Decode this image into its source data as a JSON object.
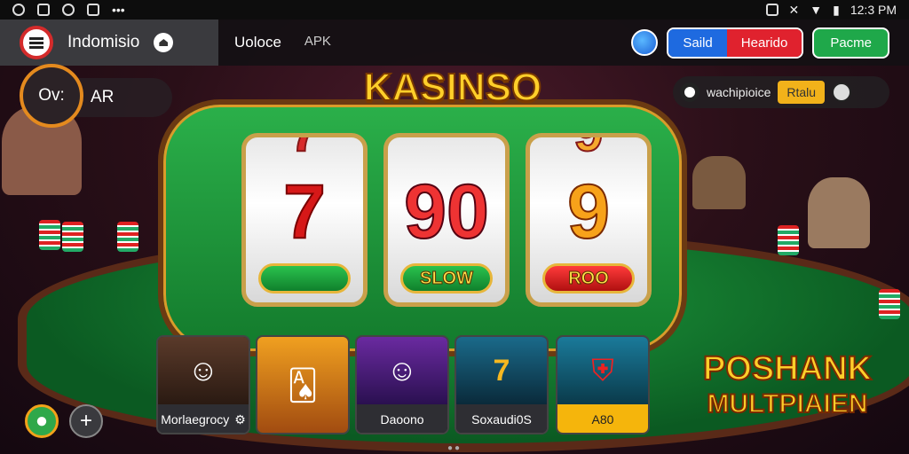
{
  "statusbar": {
    "time": "12:3 PM"
  },
  "appbar": {
    "brand": "Indomisio",
    "nav": [
      "Uoloce",
      "APK"
    ],
    "btn_blue": "Saild",
    "btn_red": "Hearido",
    "btn_green": "Pacme"
  },
  "pill": {
    "circle": "Ov:",
    "label": "AR"
  },
  "chip": {
    "text": "wachipioice",
    "tag": "Rtalu"
  },
  "game": {
    "title": "KASINSO",
    "reels": [
      {
        "symbol": "7",
        "button": ""
      },
      {
        "symbol": "90",
        "button": "SLOW"
      },
      {
        "symbol": "9",
        "button": "ROO"
      }
    ]
  },
  "cards": [
    {
      "caption": "Morlaegrocy",
      "has_icon": true
    },
    {
      "caption": "Daoono"
    },
    {
      "caption": "Soxaudi0S"
    },
    {
      "caption": "A80"
    }
  ],
  "promo": {
    "line1": "POSHANK",
    "line2": "MULTPIAIEN"
  },
  "colors": {
    "accent_green": "#1fa84a",
    "accent_red": "#e0222e",
    "accent_blue": "#1e6ae0",
    "gold": "#ffcf2a"
  }
}
